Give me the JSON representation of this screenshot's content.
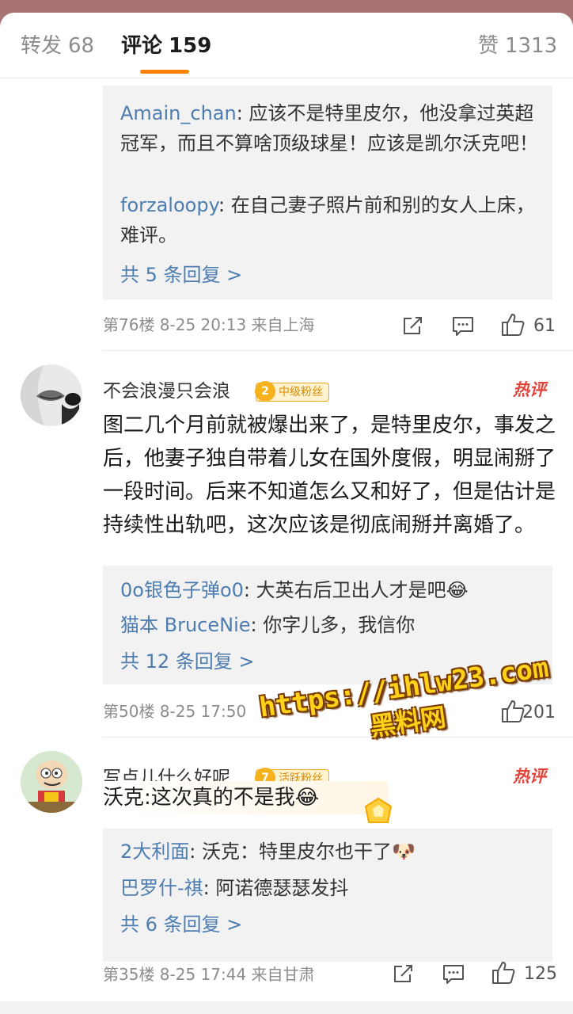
{
  "tabs": {
    "forward_label": "转发",
    "forward_count": "68",
    "comment_label": "评论",
    "comment_count": "159",
    "like_label": "赞",
    "like_count": "1313",
    "accent_color": "#ff8200"
  },
  "block1": {
    "replies": [
      {
        "name": "Amain_chan",
        "text": ": 应该不是特里皮尔，他没拿过英超冠军，而且不算啥顶级球星！应该是凯尔沃克吧！"
      },
      {
        "name": "forzaloopy",
        "text": ": 在自己妻子照片前和别的女人上床，难评。"
      }
    ],
    "more": "共 5 条回复 >",
    "meta": "第76楼  8-25 20:13  来自上海",
    "likes": "61"
  },
  "comment2": {
    "username": "不会浪漫只会浪",
    "badge_level": "2",
    "badge_text": "中级粉丝",
    "hot_label": "热评",
    "text": "图二几个月前就被爆出来了，是特里皮尔，事发之后，他妻子独自带着儿女在国外度假，明显闹掰了一段时间。后来不知道怎么又和好了，但是估计是持续性出轨吧，这次应该是彻底闹掰并离婚了。",
    "replies": [
      {
        "name": "0o银色子弹o0",
        "text": ": 大英右后卫出人才是吧😂"
      },
      {
        "name": "猫本 BruceNie",
        "text": ": 你字儿多，我信你"
      }
    ],
    "more": "共 12 条回复 >",
    "meta": "第50楼  8-25 17:50",
    "likes": "201"
  },
  "comment3": {
    "username": "写点儿什么好呢",
    "badge_level": "7",
    "badge_text": "活跃粉丝",
    "hot_label": "热评",
    "text": "沃克:这次真的不是我😂",
    "replies": [
      {
        "name": "2大利面",
        "text": ": 沃克：特里皮尔也干了🐶"
      },
      {
        "name": "巴罗什-祺",
        "text": ": 阿诺德瑟瑟发抖"
      }
    ],
    "more": "共 6 条回复 >",
    "meta": "第35楼  8-25 17:44  来自甘肃",
    "likes": "125"
  },
  "watermark": {
    "line1": "https://ihlw23.com",
    "line2": "黑料网"
  }
}
